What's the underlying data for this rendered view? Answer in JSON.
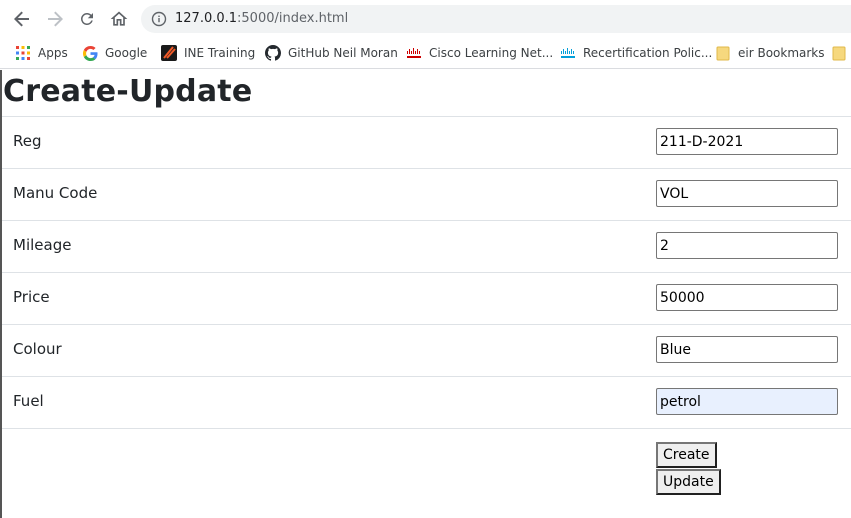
{
  "browser": {
    "url_host": "127.0.0.1",
    "url_path": ":5000/index.html",
    "icons": [
      "back-arrow-icon",
      "forward-arrow-icon",
      "reload-icon",
      "home-icon",
      "info-icon"
    ]
  },
  "bookmarks": {
    "items": [
      {
        "label": "Apps",
        "icon": "apps-grid-icon"
      },
      {
        "label": "Google",
        "icon": "google-icon"
      },
      {
        "label": "INE Training",
        "icon": "ine-icon"
      },
      {
        "label": "GitHub Neil Moran",
        "icon": "github-icon"
      },
      {
        "label": "Cisco Learning Net...",
        "icon": "cisco-icon"
      },
      {
        "label": "Recertification Polic...",
        "icon": "cisco-icon"
      },
      {
        "label": "eir Bookmarks",
        "icon": "folder-icon"
      }
    ]
  },
  "page": {
    "title": "Create-Update",
    "fields": [
      {
        "label": "Reg",
        "value": "211-D-2021"
      },
      {
        "label": "Manu Code",
        "value": "VOL"
      },
      {
        "label": "Mileage",
        "value": "2"
      },
      {
        "label": "Price",
        "value": "50000"
      },
      {
        "label": "Colour",
        "value": "Blue"
      },
      {
        "label": "Fuel",
        "value": "petrol"
      }
    ],
    "create_label": "Create",
    "update_label": "Update"
  },
  "colors": {
    "autofill": "#e8f0fe",
    "divider": "#dee2e6",
    "google_blue": "#4285f4",
    "ine_orange": "#f05a28",
    "cisco_teal": "#049fd9",
    "folder_yellow": "#f6d87e"
  }
}
